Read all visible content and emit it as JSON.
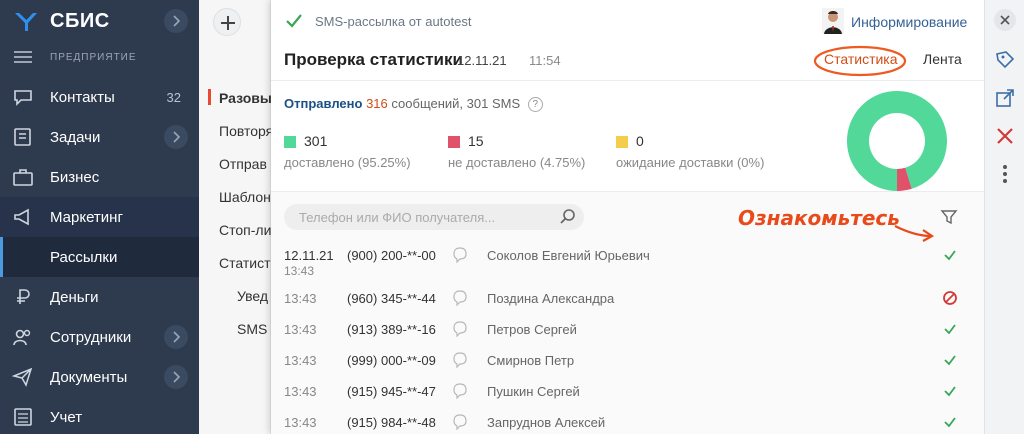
{
  "nav": {
    "brand": "СБИС",
    "org": "ПРЕДПРИЯТИЕ",
    "items": [
      {
        "label": "Контакты",
        "count": "32"
      },
      {
        "label": "Задачи"
      },
      {
        "label": "Бизнес"
      },
      {
        "label": "Маркетинг"
      },
      {
        "label": "Рассылки"
      },
      {
        "label": "Деньги"
      },
      {
        "label": "Сотрудники"
      },
      {
        "label": "Документы"
      },
      {
        "label": "Учет"
      }
    ],
    "accent": "#4c9be0"
  },
  "col2": {
    "items": [
      "Разовые",
      "Повторя",
      "Отправ",
      "Шаблон",
      "Стоп-ли",
      "Статист",
      "Увед",
      "SMS"
    ]
  },
  "panel": {
    "doc_type": "SMS-рассылка от autotest",
    "sender": "Информирование",
    "title": "Проверка статистики",
    "date": "12.11.21",
    "time": "11:54",
    "tabs": {
      "stats": "Статистика",
      "feed": "Лента"
    },
    "summary": {
      "sent_label": "Отправлено",
      "sent_count": "316",
      "sent_rest": "сообщений, 301 SMS",
      "help": "?",
      "delivered": {
        "value": "301",
        "caption": "доставлено (95.25%)",
        "color": "#52d99a"
      },
      "failed": {
        "value": "15",
        "caption": "не доставлено (4.75%)",
        "color": "#e0526a"
      },
      "pending": {
        "value": "0",
        "caption": "ожидание доставки (0%)",
        "color": "#f5cd4c"
      }
    },
    "search_placeholder": "Телефон или ФИО получателя...",
    "annotation": "Ознакомьтесь",
    "rows": [
      {
        "date": "12.11.21",
        "time": "13:43",
        "phone": "(900) 200-**-00",
        "name": "Соколов Евгений Юрьевич",
        "status": "delivered"
      },
      {
        "time": "13:43",
        "phone": "(960) 345-**-44",
        "name": "Поздина Александра",
        "status": "failed"
      },
      {
        "time": "13:43",
        "phone": "(913) 389-**-16",
        "name": "Петров Сергей",
        "status": "delivered"
      },
      {
        "time": "13:43",
        "phone": "(999) 000-**-09",
        "name": "Смирнов Петр",
        "status": "delivered"
      },
      {
        "time": "13:43",
        "phone": "(915) 945-**-47",
        "name": "Пушкин Сергей",
        "status": "delivered"
      },
      {
        "time": "13:43",
        "phone": "(915) 984-**-48",
        "name": "Запруднов Алексей",
        "status": "delivered"
      }
    ]
  },
  "chart_data": {
    "type": "pie",
    "categories": [
      "доставлено",
      "не доставлено",
      "ожидание доставки"
    ],
    "values": [
      301,
      15,
      0
    ],
    "colors": [
      "#52d99a",
      "#e0526a",
      "#f5cd4c"
    ]
  }
}
